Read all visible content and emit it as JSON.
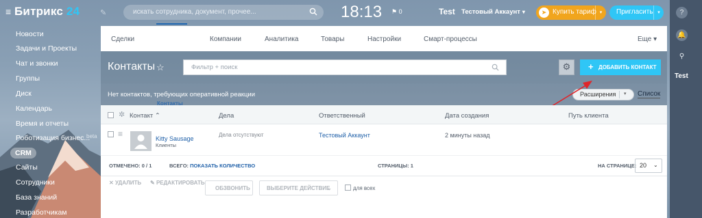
{
  "header": {
    "logo_main": "Битрикс",
    "logo_num": "24",
    "search_placeholder": "искать сотрудника, документ, прочее...",
    "clock": "18:13",
    "flag_count": "0",
    "user_short": "Test",
    "user_account": "Тестовый Аккаунт",
    "buy_label": "Купить тариф",
    "invite_label": "Пригласить"
  },
  "right_panel": {
    "user_label": "Test"
  },
  "sidebar": {
    "items": [
      {
        "label": "Новости"
      },
      {
        "label": "Задачи и Проекты"
      },
      {
        "label": "Чат и звонки"
      },
      {
        "label": "Группы"
      },
      {
        "label": "Диск"
      },
      {
        "label": "Календарь"
      },
      {
        "label": "Время и отчеты"
      },
      {
        "label": "Роботизация бизнес..."
      },
      {
        "label": "CRM"
      },
      {
        "label": "Сайты"
      },
      {
        "label": "Сотрудники"
      },
      {
        "label": "База знаний"
      },
      {
        "label": "Разработчикам"
      }
    ],
    "beta": "beta"
  },
  "tabs": [
    "Сделки",
    "Контакты",
    "Компании",
    "Аналитика",
    "Товары",
    "Настройки",
    "Смарт-процессы"
  ],
  "more_label": "Еще",
  "page": {
    "title": "Контакты",
    "filter_placeholder": "Фильтр + поиск",
    "add_button": "ДОБАВИТЬ КОНТАКТ",
    "notice": "Нет контактов, требующих оперативной реакции",
    "extensions": "Расширения",
    "list_view": "Список"
  },
  "grid": {
    "columns": [
      "Контакт",
      "Дела",
      "Ответственный",
      "Дата создания",
      "Путь клиента"
    ],
    "rows": [
      {
        "name": "Kitty Sausage",
        "type": "Клиенты",
        "deals": "Дела отсутствуют",
        "responsible": "Тестовый Аккаунт",
        "created": "2 минуты назад"
      }
    ],
    "footer": {
      "selected": "ОТМЕЧЕНО: 0 / 1",
      "total_label": "ВСЕГО:",
      "total_link": "ПОКАЗАТЬ КОЛИЧЕСТВО",
      "pages": "СТРАНИЦЫ: 1",
      "per_page_label": "НА СТРАНИЦЕ:",
      "per_page_value": "20"
    },
    "actions": {
      "delete": "УДАЛИТЬ",
      "edit": "РЕДАКТИРОВАТЬ",
      "call": "ОБЗВОНИТЬ",
      "choose_action": "ВЫБЕРИТЕ ДЕЙСТВИЕ",
      "for_all": "для всех"
    }
  },
  "colors": {
    "accent": "#2fc6f6",
    "tariff": "#f1a51d",
    "link": "#1e5fa8",
    "arrow": "#e0252a"
  }
}
